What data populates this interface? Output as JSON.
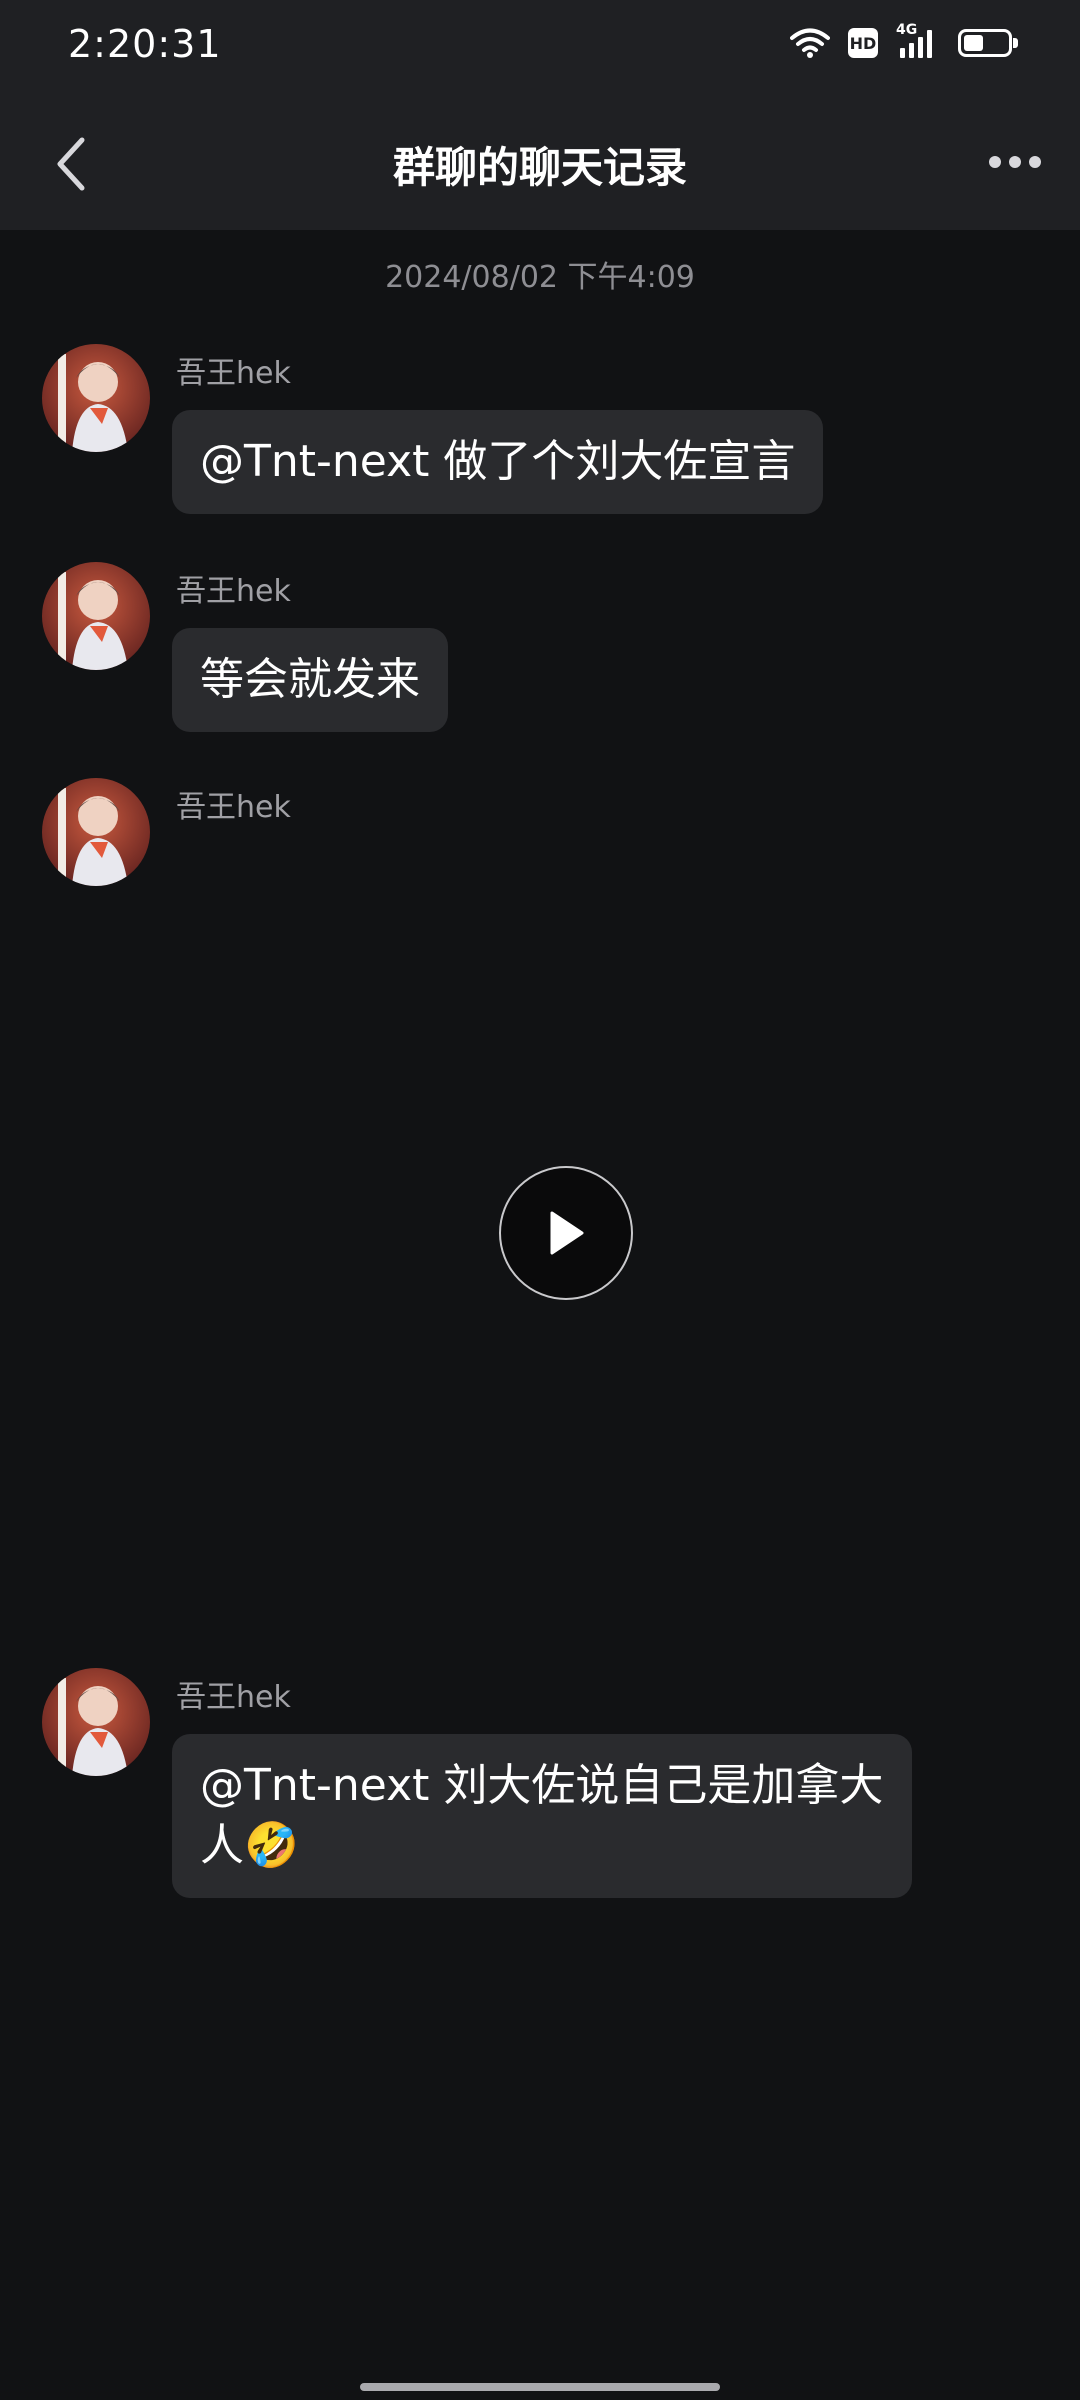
{
  "status_bar": {
    "time": "2:20:31",
    "hd_label": "HD",
    "network_label": "4G",
    "battery_level": 0.45,
    "icons": [
      "wifi-icon",
      "hd-icon",
      "signal-4g-icon",
      "battery-icon"
    ]
  },
  "header": {
    "title": "群聊的聊天记录",
    "back_icon": "chevron-left-icon",
    "more_icon": "more-dots-icon"
  },
  "chat": {
    "timestamp": "2024/08/02 下午4:09",
    "messages": [
      {
        "sender": "吾王hek",
        "type": "text",
        "text": "@Tnt-next 做了个刘大佐宣言"
      },
      {
        "sender": "吾王hek",
        "type": "text",
        "text": "等会就发来"
      },
      {
        "sender": "吾王hek",
        "type": "video",
        "text": ""
      },
      {
        "sender": "吾王hek",
        "type": "text",
        "text": "@Tnt-next 刘大佐说自己是加拿大人🤣"
      }
    ]
  },
  "colors": {
    "background": "#111214",
    "header_bg": "#1f2023",
    "bubble_bg": "#2a2b2e",
    "text": "#ffffff",
    "secondary_text": "#a0a0a5"
  }
}
